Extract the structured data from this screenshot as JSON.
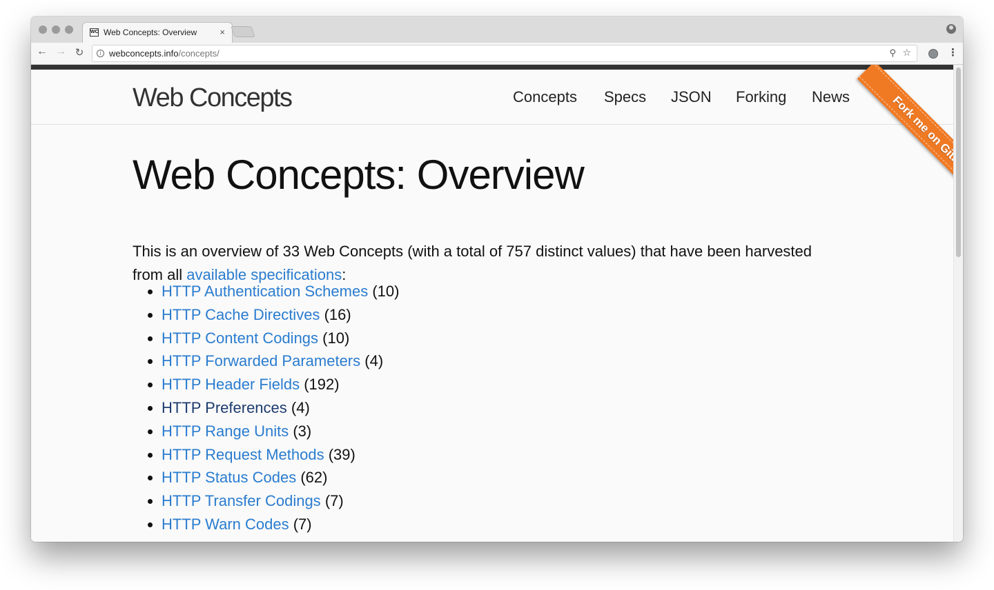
{
  "browser": {
    "tab_favicon": "WC",
    "tab_title": "Web Concepts: Overview",
    "tab_close": "×",
    "url_host": "webconcepts.info",
    "url_path": "/concepts/",
    "icons": [
      "back-icon",
      "forward-icon",
      "reload-icon",
      "info-icon",
      "zoom-icon",
      "star-icon",
      "extension-icon",
      "menu-icon",
      "profile-icon"
    ]
  },
  "header": {
    "logo": "Web Concepts",
    "nav": [
      "Concepts",
      "Specs",
      "JSON",
      "Forking",
      "News"
    ]
  },
  "ribbon": {
    "text": "Fork me on GitHub",
    "color": "#f07a24"
  },
  "main": {
    "title": "Web Concepts: Overview",
    "intro_before": "This is an overview of 33 Web Concepts (with a total of 757 distinct values) that have been harvested from all ",
    "intro_link": "available specifications",
    "intro_after": ":",
    "concepts": [
      {
        "name": "HTTP Authentication Schemes",
        "count": "(10)"
      },
      {
        "name": "HTTP Cache Directives",
        "count": "(16)"
      },
      {
        "name": "HTTP Content Codings",
        "count": "(10)"
      },
      {
        "name": "HTTP Forwarded Parameters",
        "count": "(4)"
      },
      {
        "name": "HTTP Header Fields",
        "count": "(192)"
      },
      {
        "name": "HTTP Preferences",
        "count": "(4)"
      },
      {
        "name": "HTTP Range Units",
        "count": "(3)"
      },
      {
        "name": "HTTP Request Methods",
        "count": "(39)"
      },
      {
        "name": "HTTP Status Codes",
        "count": "(62)"
      },
      {
        "name": "HTTP Transfer Codings",
        "count": "(7)"
      },
      {
        "name": "HTTP Warn Codes",
        "count": "(7)"
      }
    ]
  },
  "colors": {
    "link": "#2a7ccf",
    "visited_link": "#1d3b6e",
    "top_bar": "#333333"
  }
}
